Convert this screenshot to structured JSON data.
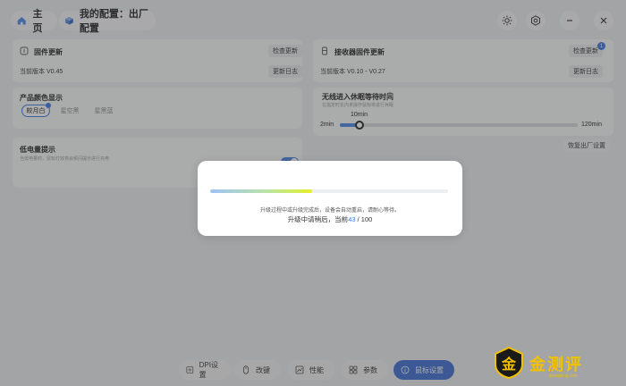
{
  "topbar": {
    "home_label": "主页",
    "config_label": "我的配置：出厂配置",
    "icons": [
      "home-icon",
      "cube-icon",
      "brightness-icon",
      "settings-hex-icon",
      "minimize-icon",
      "close-icon"
    ]
  },
  "firmware": {
    "title": "固件更新",
    "check_label": "检查更新",
    "version": "当前版本 V0.45",
    "log_label": "更新日志"
  },
  "receiver": {
    "title": "接收器固件更新",
    "check_label": "检查更新",
    "version": "当前版本 V0.10 - V0.27",
    "log_label": "更新日志",
    "badge": "1"
  },
  "color": {
    "title": "产品颜色显示",
    "options": [
      "皎月白",
      "星空黑",
      "星黑蓝"
    ],
    "selected": 0
  },
  "sleep": {
    "title": "无线进入休眠等待时间",
    "hint": "在指定时长内未操作鼠标将进行休眠",
    "value_label": "10min",
    "min_label": "2min",
    "max_label": "120min",
    "value": 10,
    "min": 2,
    "max": 120
  },
  "battery": {
    "title": "低电量提示",
    "hint": "当低电量时，鼠标灯效将会频闪提示进行充电",
    "enabled": true
  },
  "reset_label": "恢复出厂设置",
  "nav": {
    "items": [
      "DPI设置",
      "改键",
      "性能",
      "参数",
      "鼠标设置"
    ],
    "active": 4
  },
  "modal": {
    "note": "升级过程中或升级完成后，设备会自动重启，请耐心等待。",
    "status_prefix": "升级中请稍后，当前",
    "current": "43",
    "separator": " / ",
    "total": "100",
    "progress": 0.43
  },
  "watermark": {
    "badge_char": "金",
    "text": "金测评",
    "url": "jincepin g.com"
  },
  "colors": {
    "accent": "#3b78e7",
    "nav_active": "#3d6fd6",
    "watermark": "#f2c200"
  }
}
